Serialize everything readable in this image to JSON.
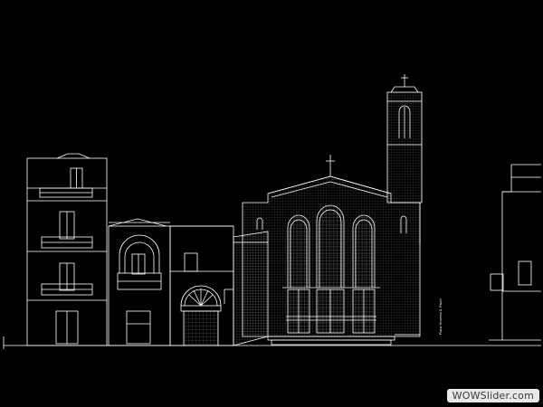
{
  "drawing": {
    "type": "architectural elevation",
    "line_color": "#ffffff",
    "background_color": "#000000",
    "vertical_side_text": "Piana Vincenzo A. Pacini"
  },
  "watermark": {
    "text": "WOWSlider.com",
    "background": "#e8e8e8"
  }
}
